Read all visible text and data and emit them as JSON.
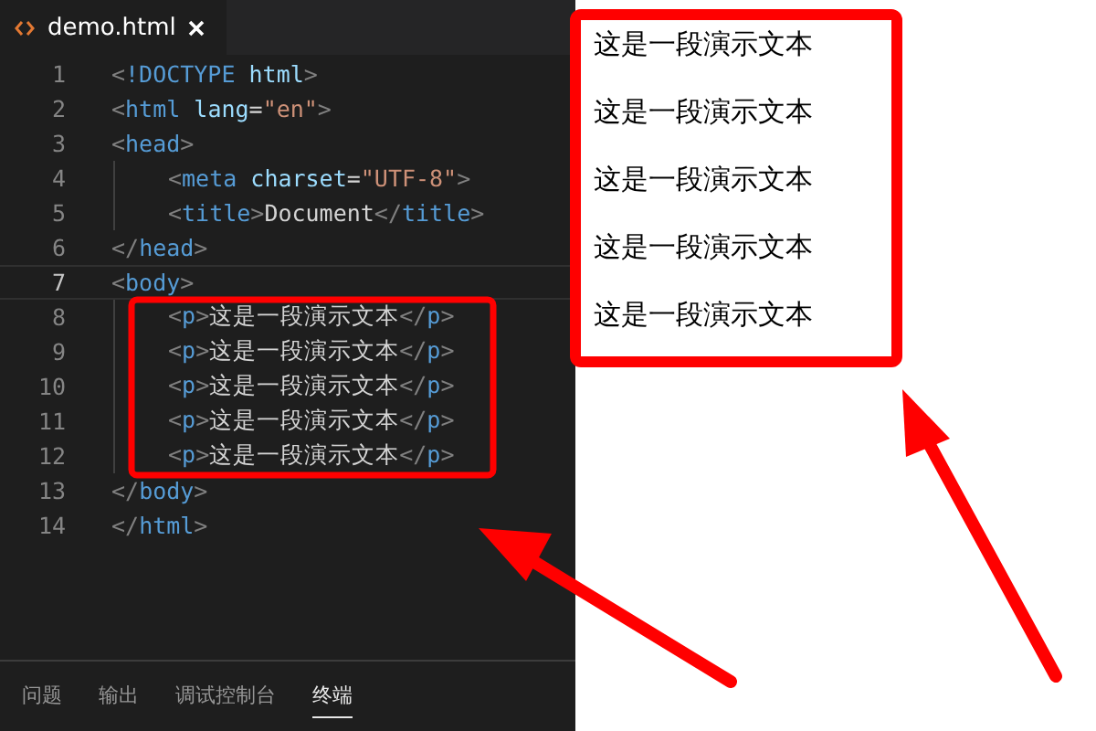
{
  "editor": {
    "tab": {
      "title": "demo.html"
    },
    "lines": [
      {
        "number": "1",
        "current": false,
        "tokens": [
          {
            "kind": "punct",
            "text": "<"
          },
          {
            "kind": "tag",
            "text": "!DOCTYPE"
          },
          {
            "kind": "attr",
            "text": " html"
          },
          {
            "kind": "punct",
            "text": ">"
          }
        ]
      },
      {
        "number": "2",
        "current": false,
        "tokens": [
          {
            "kind": "punct",
            "text": "<"
          },
          {
            "kind": "tag",
            "text": "html"
          },
          {
            "kind": "attr",
            "text": " lang"
          },
          {
            "kind": "text",
            "text": "="
          },
          {
            "kind": "string",
            "text": "\"en\""
          },
          {
            "kind": "punct",
            "text": ">"
          }
        ]
      },
      {
        "number": "3",
        "current": false,
        "tokens": [
          {
            "kind": "punct",
            "text": "<"
          },
          {
            "kind": "tag",
            "text": "head"
          },
          {
            "kind": "punct",
            "text": ">"
          }
        ],
        "children": [
          {
            "number": "4",
            "current": false,
            "tokens": [
              {
                "kind": "punct",
                "text": "<"
              },
              {
                "kind": "tag",
                "text": "meta"
              },
              {
                "kind": "attr",
                "text": " charset"
              },
              {
                "kind": "text",
                "text": "="
              },
              {
                "kind": "string",
                "text": "\"UTF-8\""
              },
              {
                "kind": "punct",
                "text": ">"
              }
            ]
          },
          {
            "number": "5",
            "current": false,
            "tokens": [
              {
                "kind": "punct",
                "text": "<"
              },
              {
                "kind": "tag",
                "text": "title"
              },
              {
                "kind": "punct",
                "text": ">"
              },
              {
                "kind": "text",
                "text": "Document"
              },
              {
                "kind": "punct",
                "text": "</"
              },
              {
                "kind": "tag",
                "text": "title"
              },
              {
                "kind": "punct",
                "text": ">"
              }
            ]
          }
        ]
      },
      {
        "number": "6",
        "current": false,
        "tokens": [
          {
            "kind": "punct",
            "text": "</"
          },
          {
            "kind": "tag",
            "text": "head"
          },
          {
            "kind": "punct",
            "text": ">"
          }
        ]
      },
      {
        "number": "7",
        "current": true,
        "tokens": [
          {
            "kind": "punct",
            "text": "<"
          },
          {
            "kind": "tag",
            "text": "body"
          },
          {
            "kind": "punct",
            "text": ">"
          }
        ],
        "children": [
          {
            "number": "8",
            "current": false,
            "tokens": [
              {
                "kind": "punct",
                "text": "<"
              },
              {
                "kind": "tag",
                "text": "p"
              },
              {
                "kind": "punct",
                "text": ">"
              },
              {
                "kind": "text",
                "text": "这是一段演示文本"
              },
              {
                "kind": "punct",
                "text": "</"
              },
              {
                "kind": "tag",
                "text": "p"
              },
              {
                "kind": "punct",
                "text": ">"
              }
            ]
          },
          {
            "number": "9",
            "current": false,
            "tokens": [
              {
                "kind": "punct",
                "text": "<"
              },
              {
                "kind": "tag",
                "text": "p"
              },
              {
                "kind": "punct",
                "text": ">"
              },
              {
                "kind": "text",
                "text": "这是一段演示文本"
              },
              {
                "kind": "punct",
                "text": "</"
              },
              {
                "kind": "tag",
                "text": "p"
              },
              {
                "kind": "punct",
                "text": ">"
              }
            ]
          },
          {
            "number": "10",
            "current": false,
            "tokens": [
              {
                "kind": "punct",
                "text": "<"
              },
              {
                "kind": "tag",
                "text": "p"
              },
              {
                "kind": "punct",
                "text": ">"
              },
              {
                "kind": "text",
                "text": "这是一段演示文本"
              },
              {
                "kind": "punct",
                "text": "</"
              },
              {
                "kind": "tag",
                "text": "p"
              },
              {
                "kind": "punct",
                "text": ">"
              }
            ]
          },
          {
            "number": "11",
            "current": false,
            "tokens": [
              {
                "kind": "punct",
                "text": "<"
              },
              {
                "kind": "tag",
                "text": "p"
              },
              {
                "kind": "punct",
                "text": ">"
              },
              {
                "kind": "text",
                "text": "这是一段演示文本"
              },
              {
                "kind": "punct",
                "text": "</"
              },
              {
                "kind": "tag",
                "text": "p"
              },
              {
                "kind": "punct",
                "text": ">"
              }
            ]
          },
          {
            "number": "12",
            "current": false,
            "tokens": [
              {
                "kind": "punct",
                "text": "<"
              },
              {
                "kind": "tag",
                "text": "p"
              },
              {
                "kind": "punct",
                "text": ">"
              },
              {
                "kind": "text",
                "text": "这是一段演示文本"
              },
              {
                "kind": "punct",
                "text": "</"
              },
              {
                "kind": "tag",
                "text": "p"
              },
              {
                "kind": "punct",
                "text": ">"
              }
            ]
          }
        ]
      },
      {
        "number": "13",
        "current": false,
        "tokens": [
          {
            "kind": "punct",
            "text": "</"
          },
          {
            "kind": "tag",
            "text": "body"
          },
          {
            "kind": "punct",
            "text": ">"
          }
        ]
      },
      {
        "number": "14",
        "current": false,
        "tokens": [
          {
            "kind": "punct",
            "text": "</"
          },
          {
            "kind": "tag",
            "text": "html"
          },
          {
            "kind": "punct",
            "text": ">"
          }
        ]
      }
    ]
  },
  "panel_tabs": [
    {
      "label": "问题",
      "selected": false
    },
    {
      "label": "输出",
      "selected": false
    },
    {
      "label": "调试控制台",
      "selected": false
    },
    {
      "label": "终端",
      "selected": true
    }
  ],
  "preview": {
    "paragraphs": [
      "这是一段演示文本",
      "这是一段演示文本",
      "这是一段演示文本",
      "这是一段演示文本",
      "这是一段演示文本"
    ]
  }
}
